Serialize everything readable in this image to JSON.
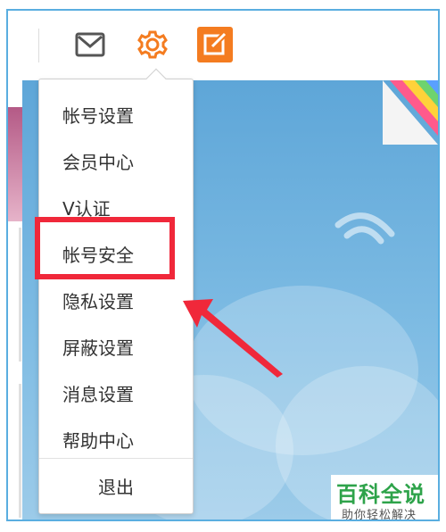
{
  "toolbar": {
    "mail_icon": "mail-icon",
    "settings_icon": "gear-icon",
    "compose_icon": "edit-icon"
  },
  "menu": {
    "items": [
      {
        "label": "帐号设置"
      },
      {
        "label": "会员中心"
      },
      {
        "label": "V认证"
      },
      {
        "label": "帐号安全"
      },
      {
        "label": "隐私设置"
      },
      {
        "label": "屏蔽设置"
      },
      {
        "label": "消息设置"
      },
      {
        "label": "帮助中心"
      }
    ],
    "logout": "退出",
    "highlighted_item": "帐号安全"
  },
  "colors": {
    "accent_orange": "#f47c20",
    "highlight_red": "#f0283a",
    "watermark_green": "#2ea34a"
  },
  "watermark": {
    "title": "百科全说",
    "subtitle": "助你轻松解决"
  }
}
